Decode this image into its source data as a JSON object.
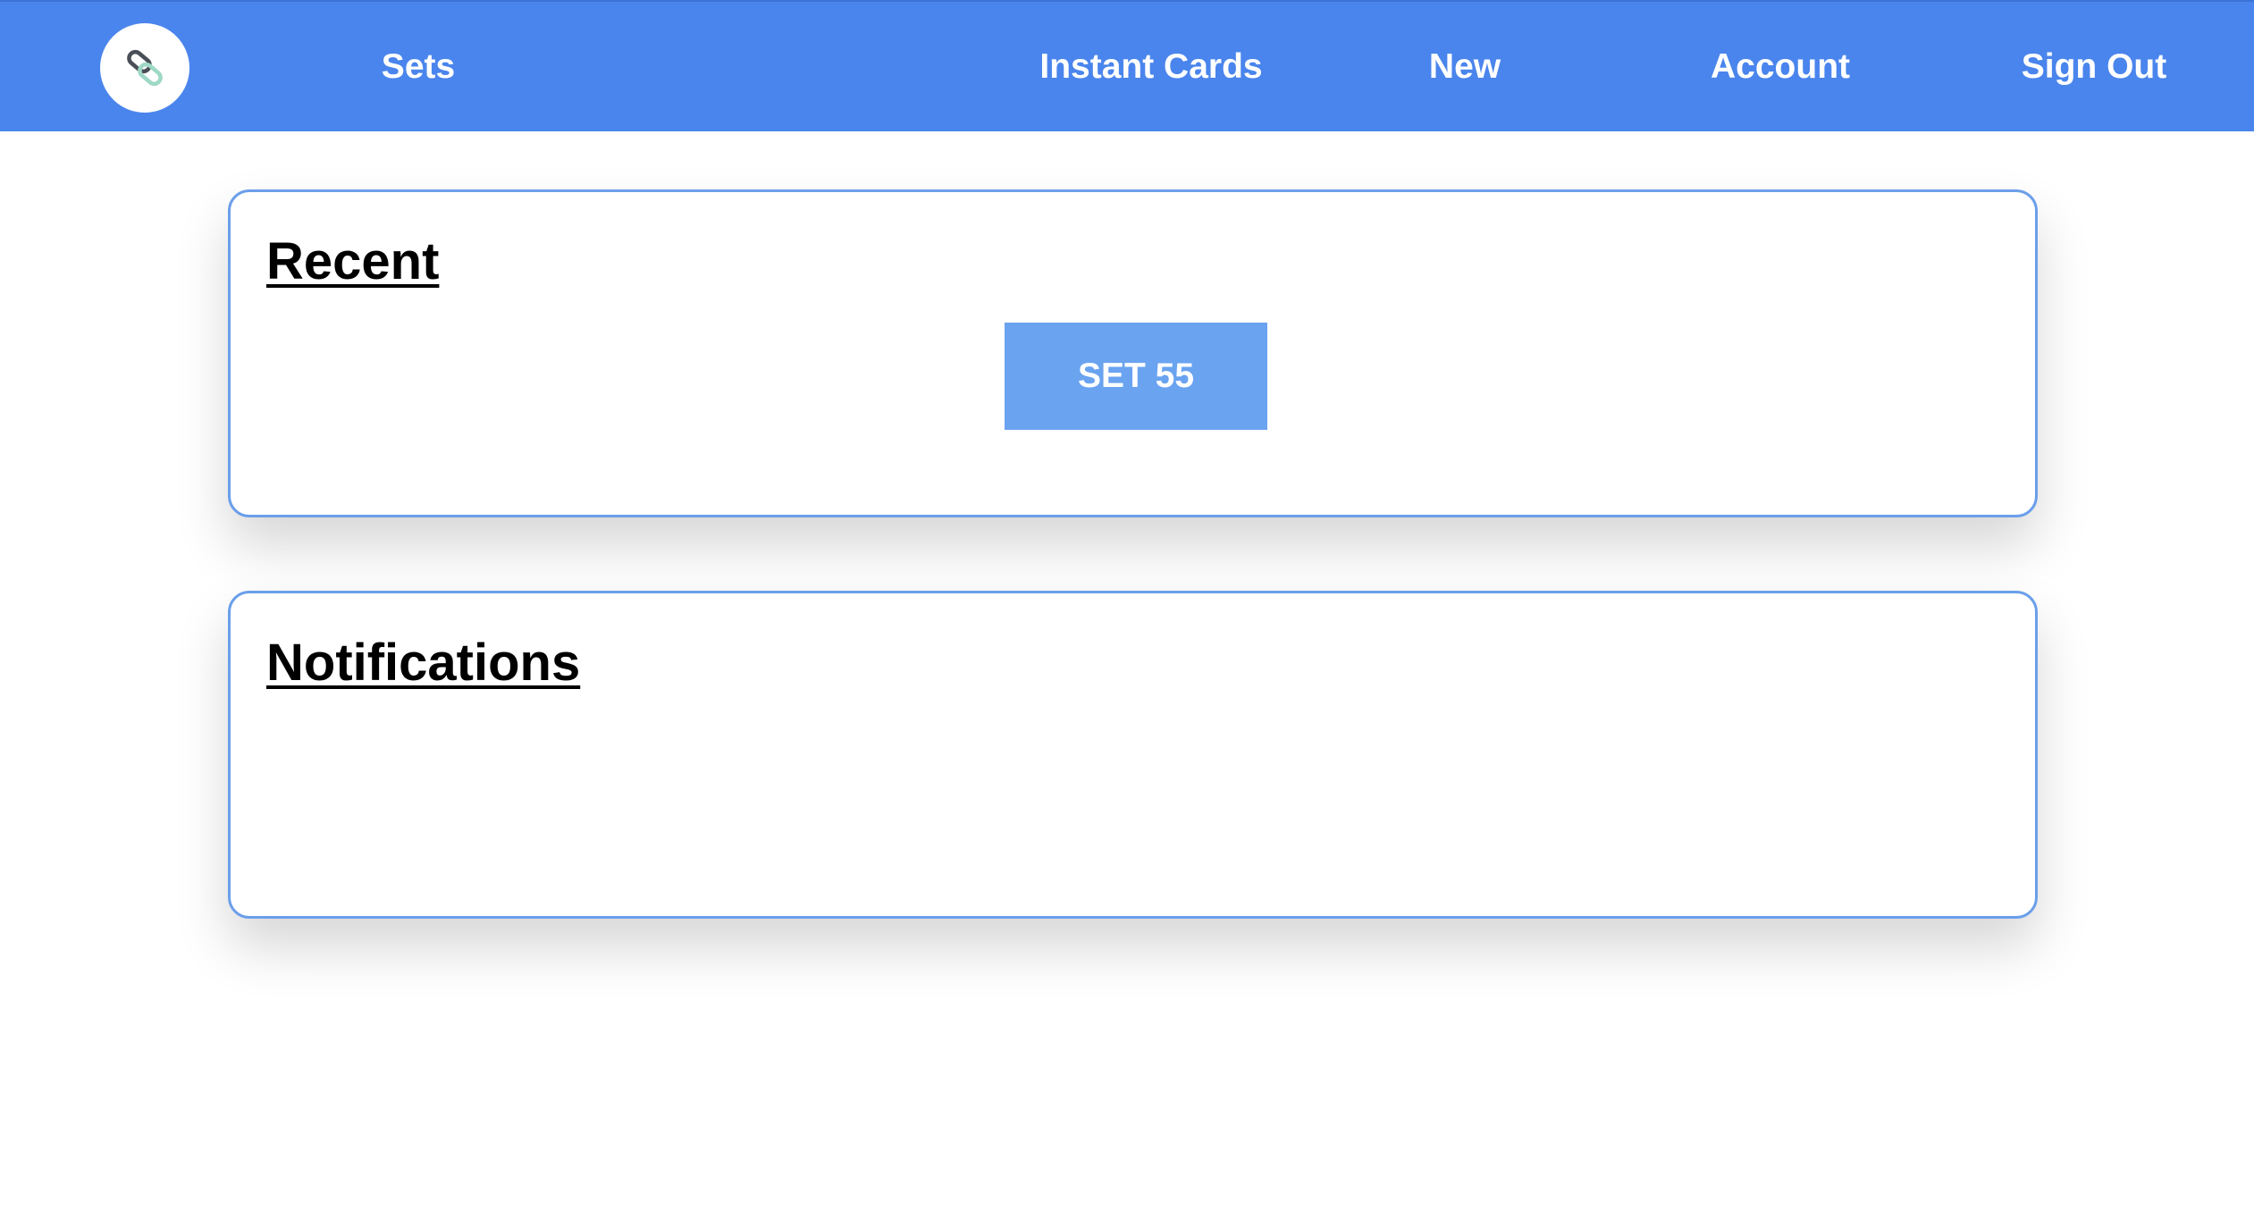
{
  "nav": {
    "logo_icon": "link-chain-icon",
    "links": [
      "Sets",
      "Instant Cards",
      "New",
      "Account",
      "Sign Out"
    ]
  },
  "recent": {
    "title": "Recent",
    "sets": [
      "SET 55"
    ]
  },
  "notifications": {
    "title": "Notifications"
  },
  "colors": {
    "navbar": "#4a85ed",
    "card_border": "#6b9fea",
    "button": "#6aa3f0"
  }
}
